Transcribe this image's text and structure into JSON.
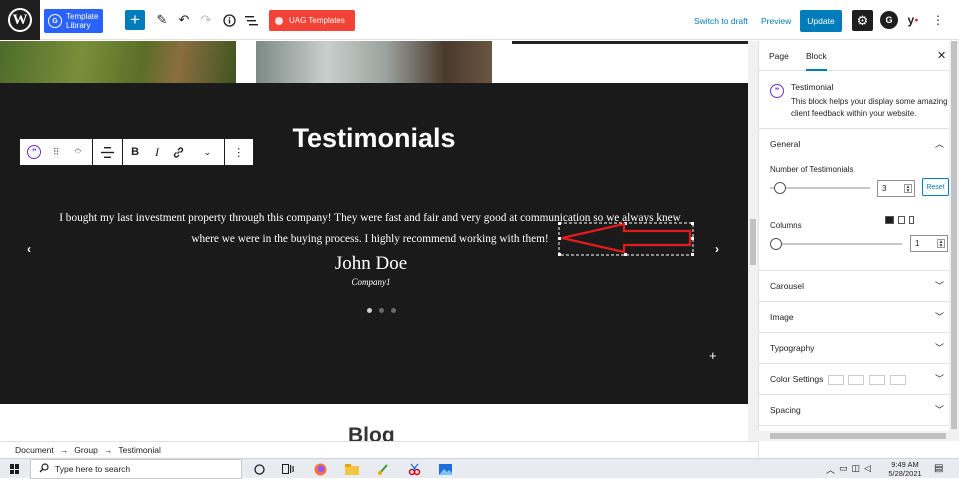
{
  "toolbar": {
    "template_library_label": "Template Library",
    "uag_templates_label": "UAG Templates",
    "switch_to_draft": "Switch to draft",
    "preview": "Preview",
    "update": "Update"
  },
  "canvas": {
    "section_title": "Testimonials",
    "testimonial": {
      "text": "I bought my last investment property through this company! They were fast and fair and very good at communication so we always knew where we were in the buying process. I highly recommend working with them!",
      "author_name": "John Doe",
      "author_company": "Company1"
    },
    "carousel_dots": 3,
    "active_dot": 0,
    "next_section_title": "Blog"
  },
  "breadcrumbs": [
    "Document",
    "Group",
    "Testimonial"
  ],
  "sidebar": {
    "tabs": [
      "Page",
      "Block"
    ],
    "active_tab": "Block",
    "block": {
      "name": "Testimonial",
      "description": "This block helps your display some amazing client feedback within your website."
    },
    "general": {
      "label": "General",
      "number_of_testimonials_label": "Number of Testimonials",
      "number_of_testimonials": "3",
      "reset_label": "Reset",
      "columns_label": "Columns",
      "columns": "1"
    },
    "panels": [
      "Carousel",
      "Image",
      "Typography",
      "Color Settings",
      "Spacing"
    ]
  },
  "taskbar": {
    "search_placeholder": "Type here to search",
    "time": "9:49 AM",
    "date": "5/28/2021"
  },
  "colors": {
    "wp_blue": "#007cba",
    "section_bg": "#1a1a1a",
    "annotation_red": "#e31b1b",
    "uag_red": "#f44336"
  }
}
